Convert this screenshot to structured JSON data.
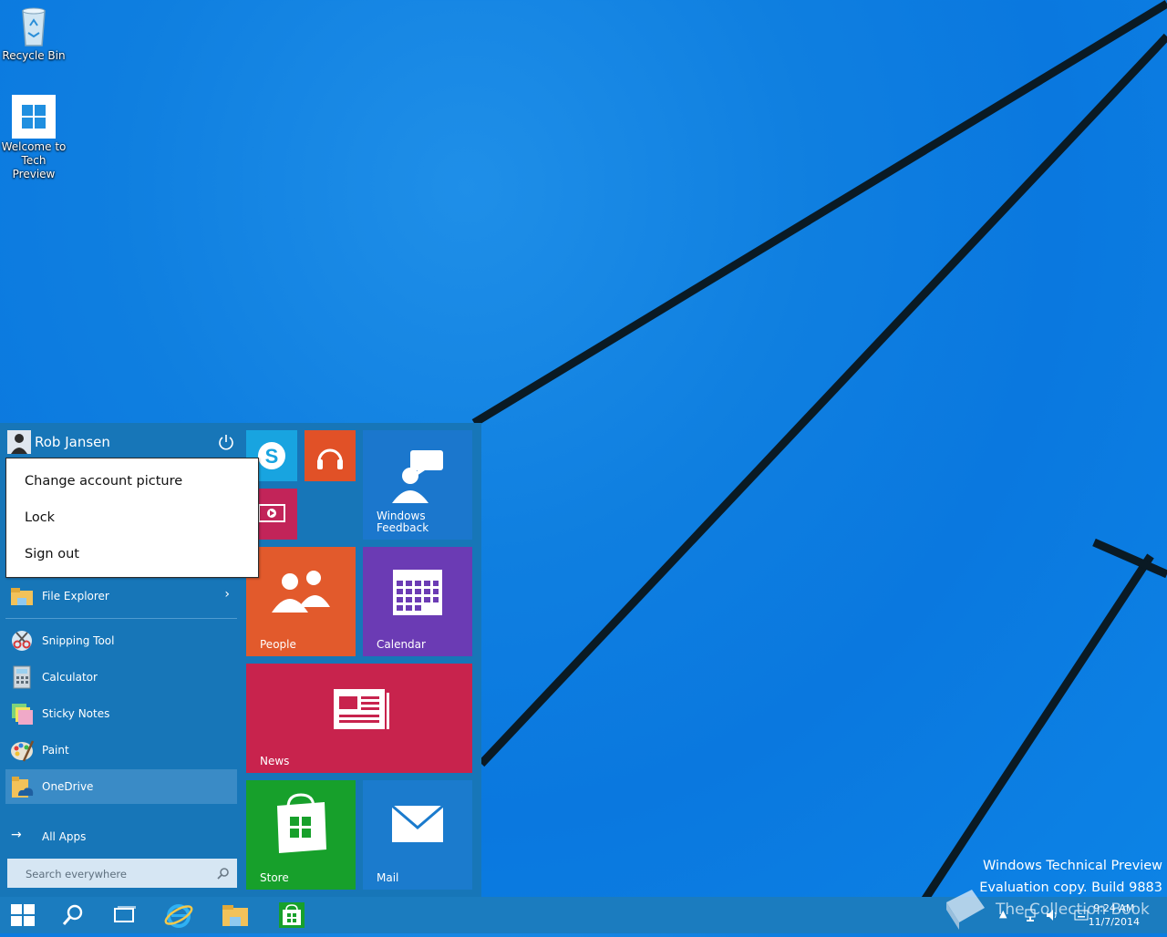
{
  "desktop": {
    "icons": [
      {
        "label": "Recycle Bin"
      },
      {
        "label": "Welcome to Tech Preview"
      }
    ],
    "watermark": {
      "line1": "Windows Technical Preview",
      "line2": "Evaluation copy. Build 9883"
    },
    "overlay_logo_text": "The Collection Book"
  },
  "start_menu": {
    "user_name": "Rob Jansen",
    "account_menu": [
      "Change account picture",
      "Lock",
      "Sign out"
    ],
    "apps": [
      {
        "label": "File Explorer",
        "icon": "folder-icon"
      },
      {
        "label": "Snipping Tool",
        "icon": "scissors-icon"
      },
      {
        "label": "Calculator",
        "icon": "calculator-icon"
      },
      {
        "label": "Sticky Notes",
        "icon": "sticky-notes-icon"
      },
      {
        "label": "Paint",
        "icon": "palette-icon"
      },
      {
        "label": "OneDrive",
        "icon": "onedrive-icon"
      }
    ],
    "all_apps_label": "All Apps",
    "search_placeholder": "Search everywhere",
    "tiles": {
      "windows_feedback": "Windows Feedback",
      "people": "People",
      "calendar": "Calendar",
      "news": "News",
      "store": "Store",
      "mail": "Mail"
    }
  },
  "taskbar": {
    "time": "9:24 AM",
    "date": "11/7/2014"
  },
  "colors": {
    "start_bg": "#1776b8",
    "taskbar_bg": "#1b7cbf",
    "tile_skype": "#18a4e0",
    "tile_music": "#e15127",
    "tile_video": "#c22459",
    "tile_feedback": "#1b77cd",
    "tile_people": "#e25a2c",
    "tile_calendar": "#6b3bb4",
    "tile_news": "#c8234d",
    "tile_store": "#17a02b",
    "tile_mail": "#1b7bcd"
  }
}
